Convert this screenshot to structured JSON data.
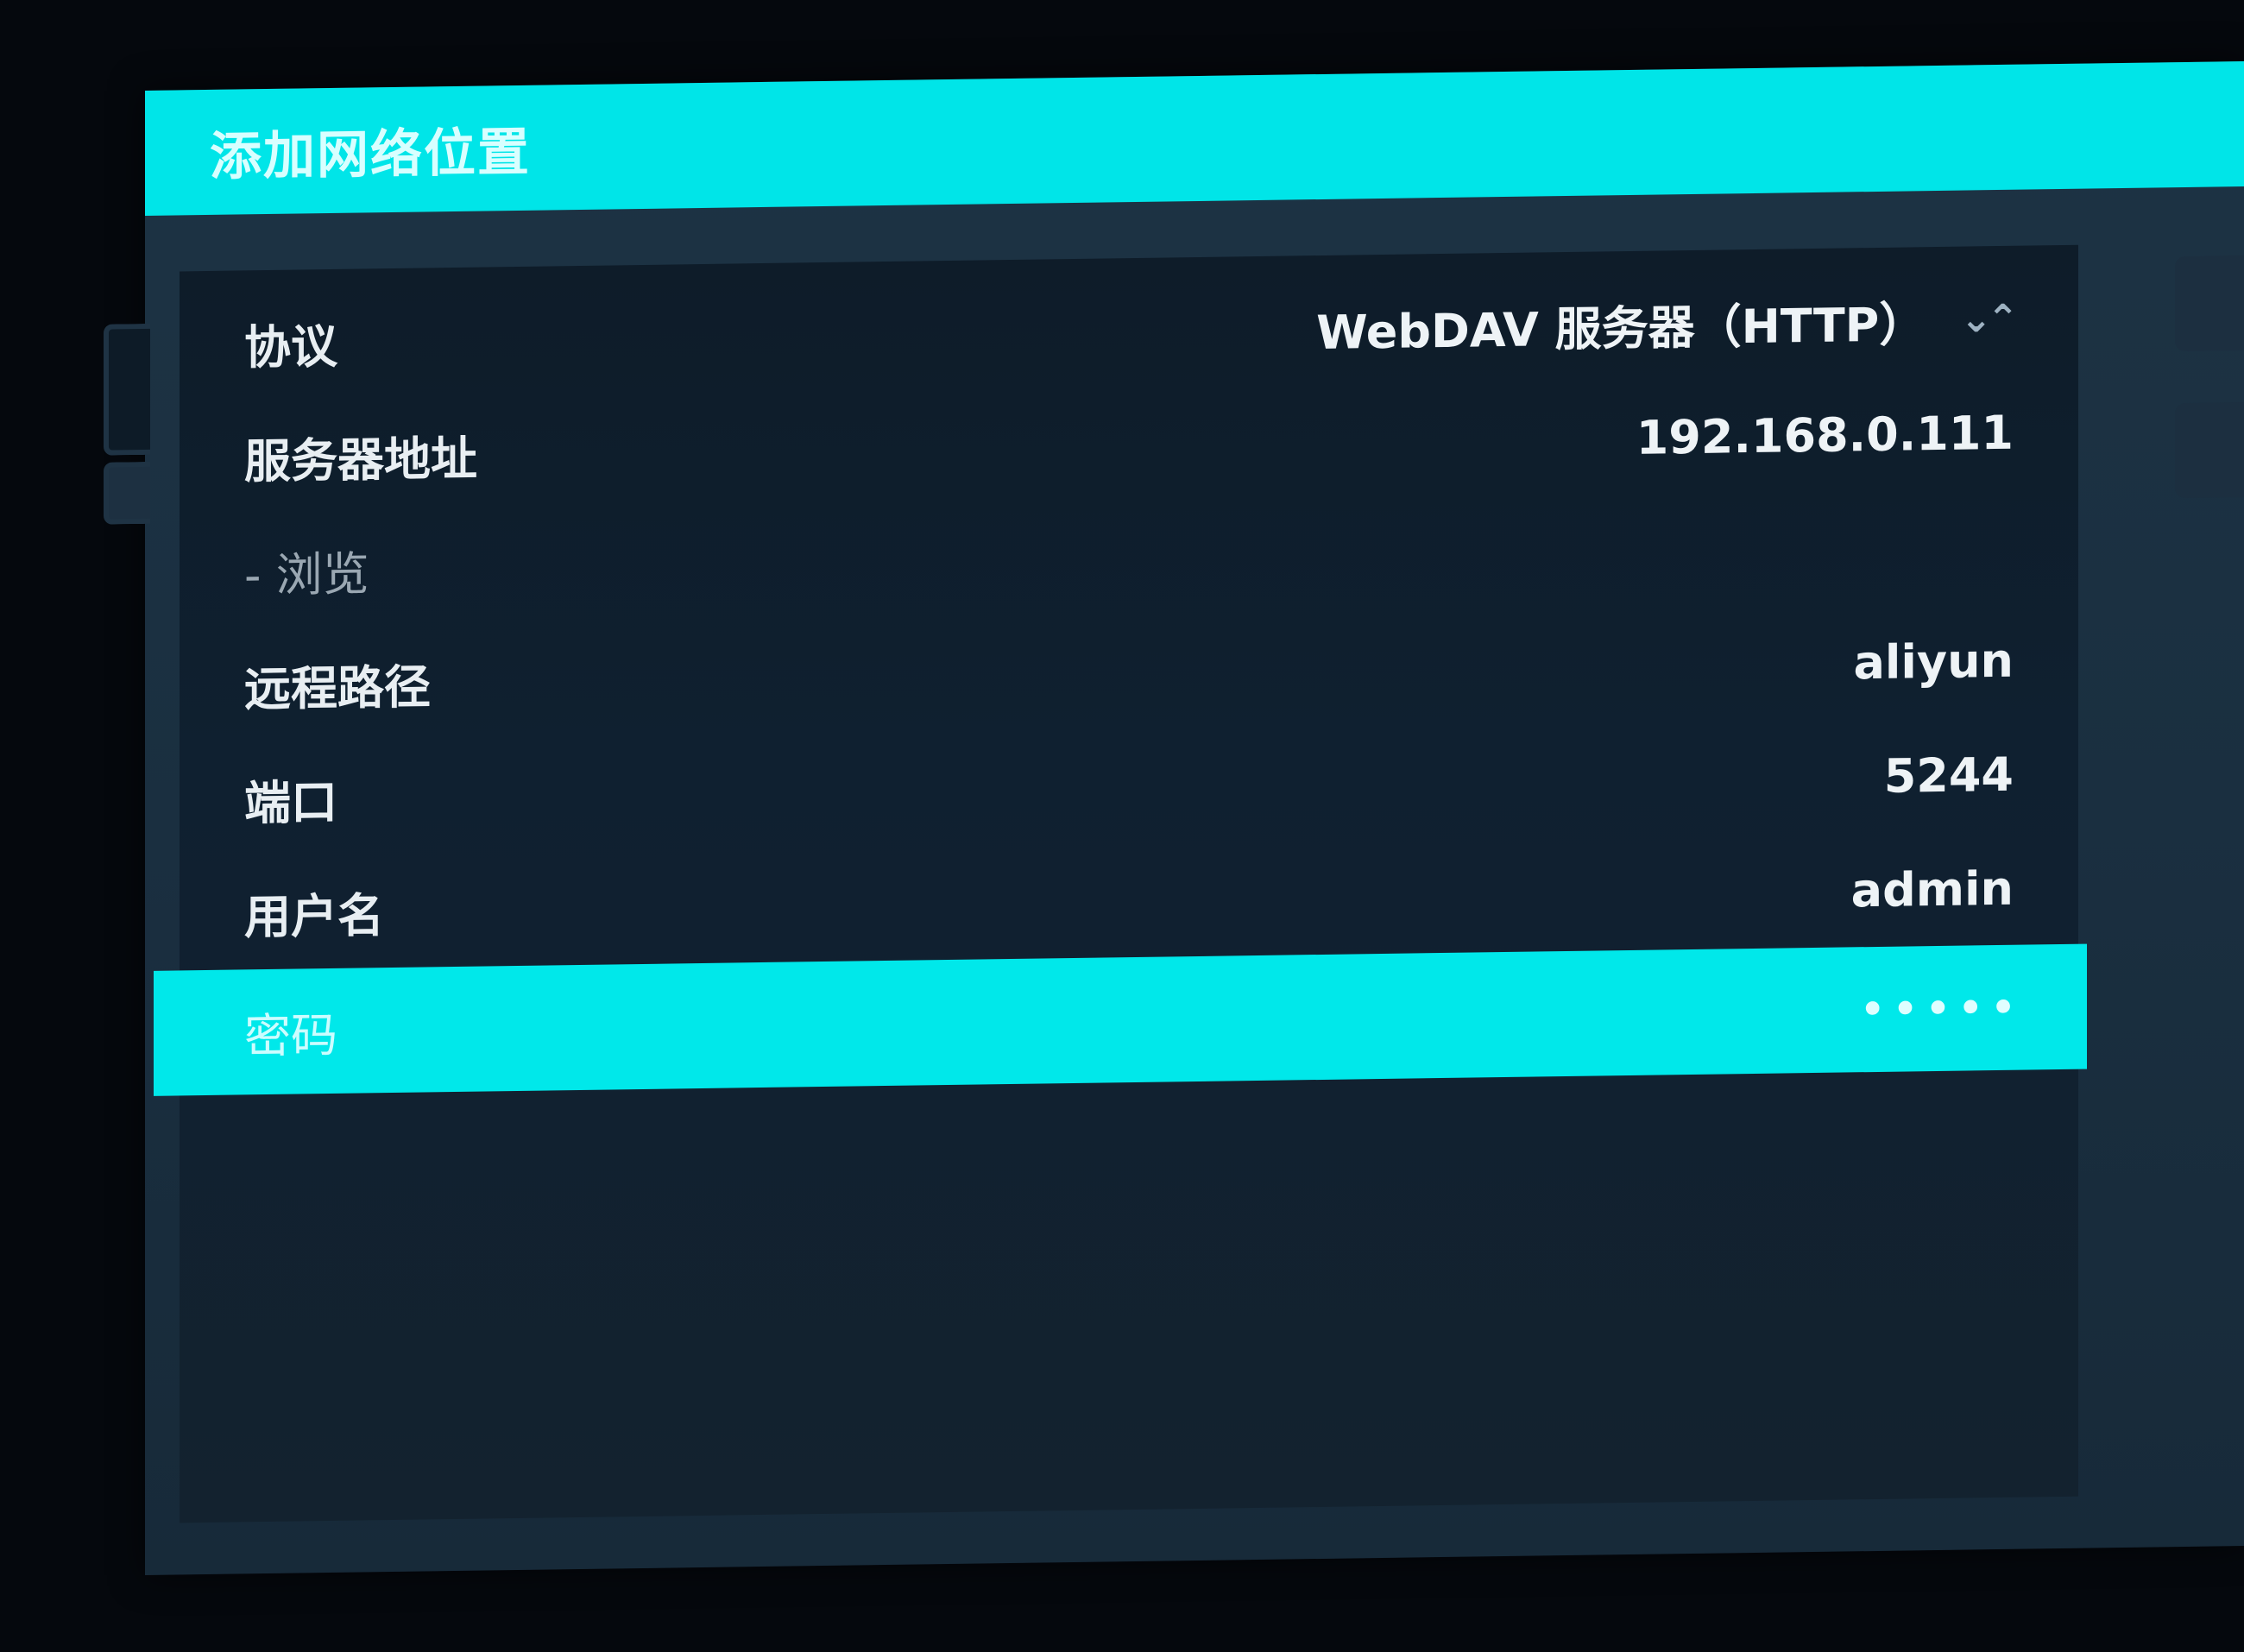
{
  "dialog": {
    "title": "添加网络位置"
  },
  "settings": [
    {
      "label": "协议",
      "value": "WebDAV 服务器（HTTP）"
    },
    {
      "label": "服务器地址",
      "value": "192.168.0.111"
    },
    {
      "label": "- 浏览",
      "value": ""
    },
    {
      "label": "远程路径",
      "value": "aliyun"
    },
    {
      "label": "端口",
      "value": "5244"
    },
    {
      "label": "用户名",
      "value": "admin"
    },
    {
      "label": "密码",
      "value": "•••••"
    }
  ],
  "icons": {
    "protocol_spinner": "chevron-down-up-icon"
  },
  "colors": {
    "accent": "#00e5e8",
    "panel": "#0f1f2e",
    "background": "#05080d"
  }
}
